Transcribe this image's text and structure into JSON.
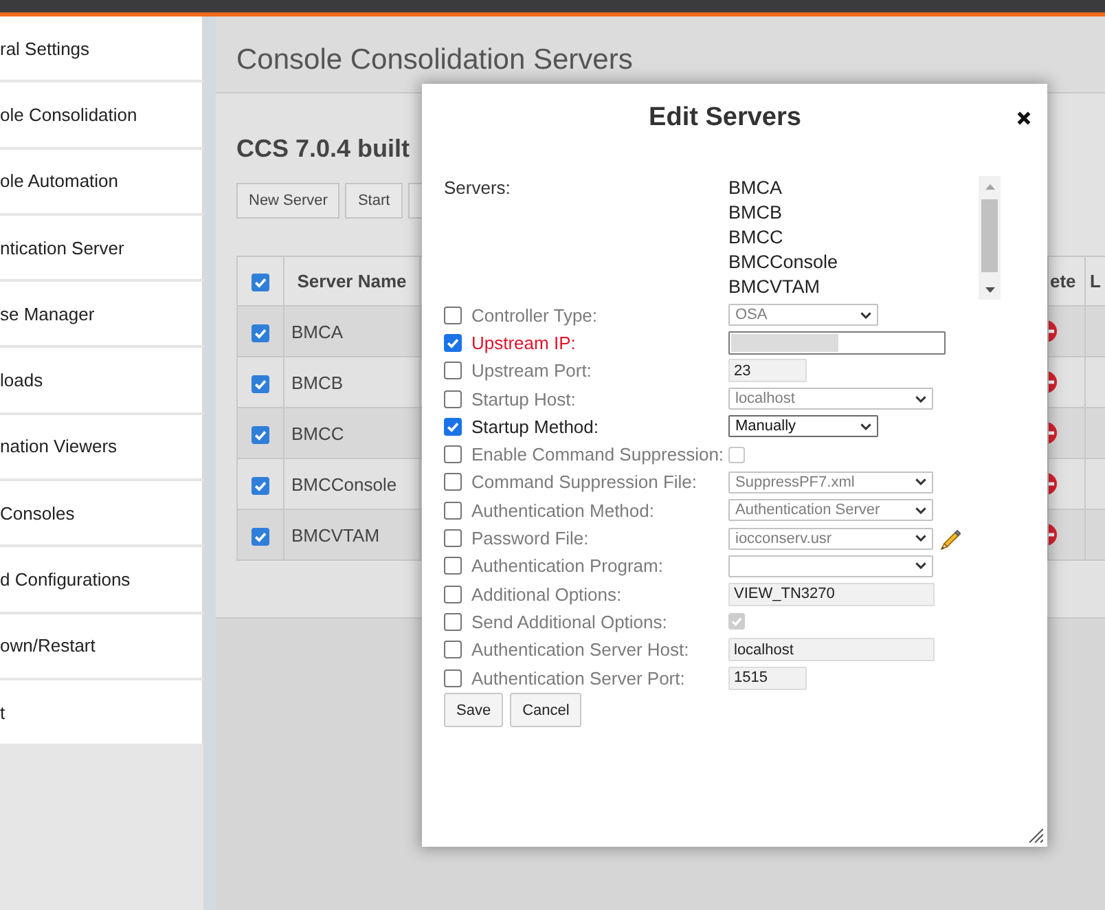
{
  "sidebar": {
    "items": [
      "ral Settings",
      "ole Consolidation",
      "ole Automation",
      "ntication Server",
      "se Manager",
      "loads",
      "nation Viewers",
      "Consoles",
      "d Configurations",
      "own/Restart",
      "t"
    ]
  },
  "main": {
    "title": "Console Consolidation Servers",
    "heading": "CCS 7.0.4 built",
    "toolbar": [
      {
        "kind": "full",
        "label": "New Server"
      },
      {
        "kind": "full",
        "label": "Start"
      },
      {
        "kind": "cut"
      }
    ],
    "table": {
      "header_checked": true,
      "columns": [
        "Server Name",
        "ete",
        "L"
      ],
      "rows": [
        {
          "checked": true,
          "name": "BMCA"
        },
        {
          "checked": true,
          "name": "BMCB"
        },
        {
          "checked": true,
          "name": "BMCC"
        },
        {
          "checked": true,
          "name": "BMCConsole"
        },
        {
          "checked": true,
          "name": "BMCVTAM"
        }
      ]
    }
  },
  "dialog": {
    "title": "Edit Servers",
    "servers_label": "Servers:",
    "servers": [
      {
        "name": "BMCA",
        "selected": false
      },
      {
        "name": "BMCB",
        "selected": false
      },
      {
        "name": "BMCC",
        "selected": false
      },
      {
        "name": "BMCConsole",
        "selected": false
      },
      {
        "name": "BMCVTAM",
        "selected": false
      }
    ],
    "fields": [
      {
        "label": "Controller Type:",
        "checked": false,
        "invalid": false,
        "edit_button": false,
        "control": {
          "kind": "select",
          "value": "OSA"
        }
      },
      {
        "label": "Upstream IP:",
        "checked": true,
        "invalid": true,
        "edit_button": false,
        "control": {
          "kind": "input",
          "redacted": true
        }
      },
      {
        "label": "Upstream Port:",
        "checked": false,
        "invalid": false,
        "edit_button": false,
        "control": {
          "kind": "input",
          "redacted": false,
          "value": "23"
        }
      },
      {
        "label": "Startup Host:",
        "checked": false,
        "invalid": false,
        "edit_button": false,
        "control": {
          "kind": "select",
          "value": "localhost"
        }
      },
      {
        "label": "Startup Method:",
        "checked": true,
        "invalid": false,
        "edit_button": false,
        "control": {
          "kind": "select",
          "value": "Manually"
        }
      },
      {
        "label": "Enable Command Suppression:",
        "checked": false,
        "invalid": false,
        "edit_button": false,
        "control": {
          "kind": "checkbox",
          "checked": false
        }
      },
      {
        "label": "Command Suppression File:",
        "checked": false,
        "invalid": false,
        "edit_button": false,
        "control": {
          "kind": "select",
          "value": "SuppressPF7.xml"
        }
      },
      {
        "label": "Authentication Method:",
        "checked": false,
        "invalid": false,
        "edit_button": false,
        "control": {
          "kind": "select",
          "value": "Authentication Server"
        }
      },
      {
        "label": "Password File:",
        "checked": false,
        "invalid": false,
        "edit_button": true,
        "control": {
          "kind": "select",
          "value": "iocconserv.usr"
        }
      },
      {
        "label": "Authentication Program:",
        "checked": false,
        "invalid": false,
        "edit_button": false,
        "control": {
          "kind": "select"
        }
      },
      {
        "label": "Additional Options:",
        "checked": false,
        "invalid": false,
        "edit_button": false,
        "control": {
          "kind": "input",
          "redacted": false,
          "value": "VIEW_TN3270"
        }
      },
      {
        "label": "Send Additional Options:",
        "checked": false,
        "invalid": false,
        "edit_button": false,
        "control": {
          "kind": "checkbox",
          "checked": true
        }
      },
      {
        "label": "Authentication Server Host:",
        "checked": false,
        "invalid": false,
        "edit_button": false,
        "control": {
          "kind": "input",
          "redacted": false,
          "value": "localhost"
        }
      },
      {
        "label": "Authentication Server Port:",
        "checked": false,
        "invalid": false,
        "edit_button": false,
        "control": {
          "kind": "input",
          "redacted": false,
          "value": "1515"
        }
      }
    ],
    "buttons": [
      "Save",
      "Cancel"
    ]
  }
}
